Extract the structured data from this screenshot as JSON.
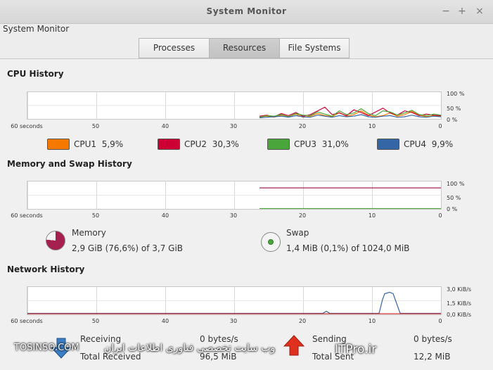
{
  "window": {
    "title": "System Monitor",
    "app_name": "System Monitor",
    "controls": {
      "minimize": "−",
      "maximize": "+",
      "close": "×"
    }
  },
  "tabs": [
    {
      "label": "Processes",
      "active": false
    },
    {
      "label": "Resources",
      "active": true
    },
    {
      "label": "File Systems",
      "active": false
    }
  ],
  "cpu": {
    "title": "CPU History",
    "x_labels": [
      "60 seconds",
      "50",
      "40",
      "30",
      "20",
      "10",
      "0"
    ],
    "y_labels": [
      "100 %",
      "50 %",
      "0 %"
    ],
    "cpus": [
      {
        "label": "CPU1",
        "value": "5,9%",
        "color": "#f57900"
      },
      {
        "label": "CPU2",
        "value": "30,3%",
        "color": "#cc0033"
      },
      {
        "label": "CPU3",
        "value": "31,0%",
        "color": "#4aa63a"
      },
      {
        "label": "CPU4",
        "value": "9,9%",
        "color": "#3465a4"
      }
    ],
    "series": [
      [
        8,
        10,
        6,
        14,
        8,
        18,
        6,
        10,
        20,
        12,
        8,
        24,
        10,
        16,
        30,
        14,
        8,
        12,
        22,
        10,
        16,
        28,
        14,
        8,
        12,
        10
      ],
      [
        10,
        14,
        8,
        20,
        12,
        24,
        10,
        16,
        30,
        44,
        16,
        22,
        12,
        34,
        24,
        12,
        26,
        40,
        22,
        14,
        30,
        24,
        12,
        18,
        14,
        12
      ],
      [
        6,
        12,
        10,
        16,
        8,
        20,
        14,
        12,
        26,
        18,
        10,
        30,
        16,
        22,
        38,
        20,
        12,
        30,
        26,
        14,
        22,
        32,
        16,
        12,
        18,
        14
      ],
      [
        4,
        6,
        8,
        10,
        6,
        12,
        8,
        6,
        14,
        10,
        6,
        12,
        8,
        10,
        16,
        8,
        6,
        10,
        12,
        6,
        8,
        14,
        8,
        6,
        10,
        8
      ]
    ]
  },
  "memory": {
    "title": "Memory and Swap History",
    "x_labels": [
      "60 seconds",
      "50",
      "40",
      "30",
      "20",
      "10",
      "0"
    ],
    "y_labels": [
      "100 %",
      "50 %",
      "0 %"
    ],
    "memory": {
      "label": "Memory",
      "value": "2,9 GiB (76,6%) of 3,7 GiB",
      "fraction": 0.766,
      "color": "#a6204f"
    },
    "swap": {
      "label": "Swap",
      "value": "1,4 MiB (0,1%) of 1024,0 MiB",
      "fraction": 0.001,
      "color": "#4aa63a"
    }
  },
  "network": {
    "title": "Network History",
    "x_labels": [
      "60 seconds",
      "50",
      "40",
      "30",
      "20",
      "10",
      "0"
    ],
    "y_labels": [
      "3,0 KiB/s",
      "1,5 KiB/s",
      "0,0 KiB/s"
    ],
    "receiving": {
      "label": "Receiving",
      "rate": "0 bytes/s",
      "total_label": "Total Received",
      "total": "96,5 MiB",
      "color": "#3465a4"
    },
    "sending": {
      "label": "Sending",
      "rate": "0 bytes/s",
      "total_label": "Total Sent",
      "total": "12,2 MiB",
      "color": "#cc0000"
    }
  },
  "watermark": {
    "left": "TOSINSO.COM",
    "middle": "وب سایت تخصصی فناوری اطلاعات ایران",
    "right": "ITPro.ir"
  }
}
